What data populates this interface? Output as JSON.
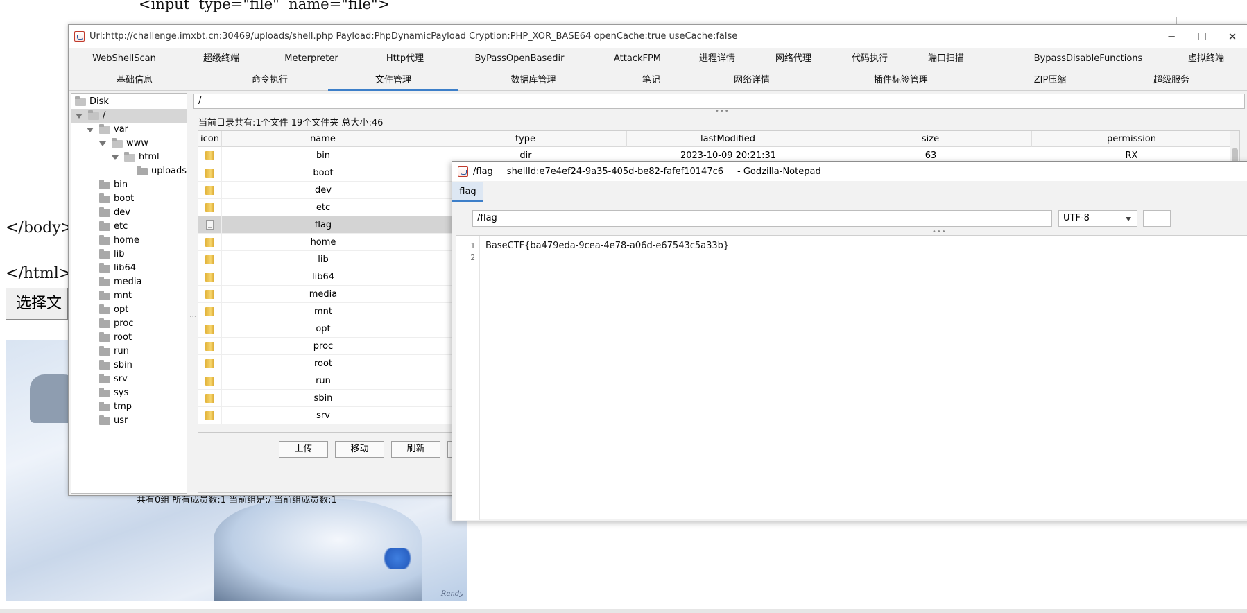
{
  "background_page": {
    "code_line": "<input  type=\"file\"  name=\"file\">",
    "body_close": "</body>",
    "html_close": "</html>",
    "choose_file_button": "选择文",
    "status_text": "共有0组 所有成员数:1 当前组是:/ 当前组成员数:1",
    "image_signature": "Randy"
  },
  "main_window": {
    "title": "Url:http://challenge.imxbt.cn:30469/uploads/shell.php Payload:PhpDynamicPayload Cryption:PHP_XOR_BASE64 openCache:true useCache:false",
    "controls": {
      "minimize": "─",
      "maximize": "☐",
      "close": "✕"
    },
    "tabs_row1": [
      "WebShellScan",
      "超级终端",
      "Meterpreter",
      "Http代理",
      "ByPassOpenBasedir",
      "AttackFPM",
      "进程详情",
      "网络代理",
      "代码执行",
      "端口扫描",
      "BypassDisableFunctions",
      "虚拟终端"
    ],
    "tabs_row2": [
      "基础信息",
      "命令执行",
      "文件管理",
      "数据库管理",
      "笔记",
      "网络详情",
      "插件标签管理",
      "ZIP压缩",
      "超级服务"
    ],
    "active_tab": "文件管理"
  },
  "tree": {
    "root": "Disk",
    "nodes": [
      "/",
      "var",
      "www",
      "html",
      "uploads",
      "bin",
      "boot",
      "dev",
      "etc",
      "home",
      "lib",
      "lib64",
      "media",
      "mnt",
      "opt",
      "proc",
      "root",
      "run",
      "sbin",
      "srv",
      "sys",
      "tmp",
      "usr"
    ]
  },
  "file_manager": {
    "path": "/",
    "summary": "当前目录共有:1个文件 19个文件夹 总大小:46",
    "columns": [
      "icon",
      "name",
      "type",
      "lastModified",
      "size",
      "permission"
    ],
    "rows": [
      {
        "name": "bin",
        "type": "dir",
        "lastModified": "2023-10-09 20:21:31",
        "size": "63",
        "permission": "RX",
        "icon": "folder-icon"
      },
      {
        "name": "boot",
        "icon": "folder-icon"
      },
      {
        "name": "dev",
        "icon": "folder-icon"
      },
      {
        "name": "etc",
        "icon": "folder-icon"
      },
      {
        "name": "flag",
        "icon": "file-icon"
      },
      {
        "name": "home",
        "icon": "folder-icon"
      },
      {
        "name": "lib",
        "icon": "folder-icon"
      },
      {
        "name": "lib64",
        "icon": "folder-icon"
      },
      {
        "name": "media",
        "icon": "folder-icon"
      },
      {
        "name": "mnt",
        "icon": "folder-icon"
      },
      {
        "name": "opt",
        "icon": "folder-icon"
      },
      {
        "name": "proc",
        "icon": "folder-icon"
      },
      {
        "name": "root",
        "icon": "folder-icon"
      },
      {
        "name": "run",
        "icon": "folder-icon"
      },
      {
        "name": "sbin",
        "icon": "folder-icon"
      },
      {
        "name": "srv",
        "icon": "folder-icon"
      }
    ],
    "selected_row": "flag",
    "buttons": [
      "上传",
      "移动",
      "刷新"
    ]
  },
  "notepad": {
    "title_file": "/flag",
    "title_shell": "shellId:e7e4ef24-9a35-405d-be82-fafef10147c6",
    "title_app": "- Godzilla-Notepad",
    "tab": "flag",
    "path": "/flag",
    "encoding": "UTF-8",
    "line_numbers": [
      "1",
      "2"
    ],
    "content": "BaseCTF{ba479eda-9cea-4e78-a06d-e67543c5a33b}"
  },
  "colors": {
    "accent": "#3d7fc9",
    "selected_row": "#d4d4d4",
    "folder": "#f6d56d"
  }
}
